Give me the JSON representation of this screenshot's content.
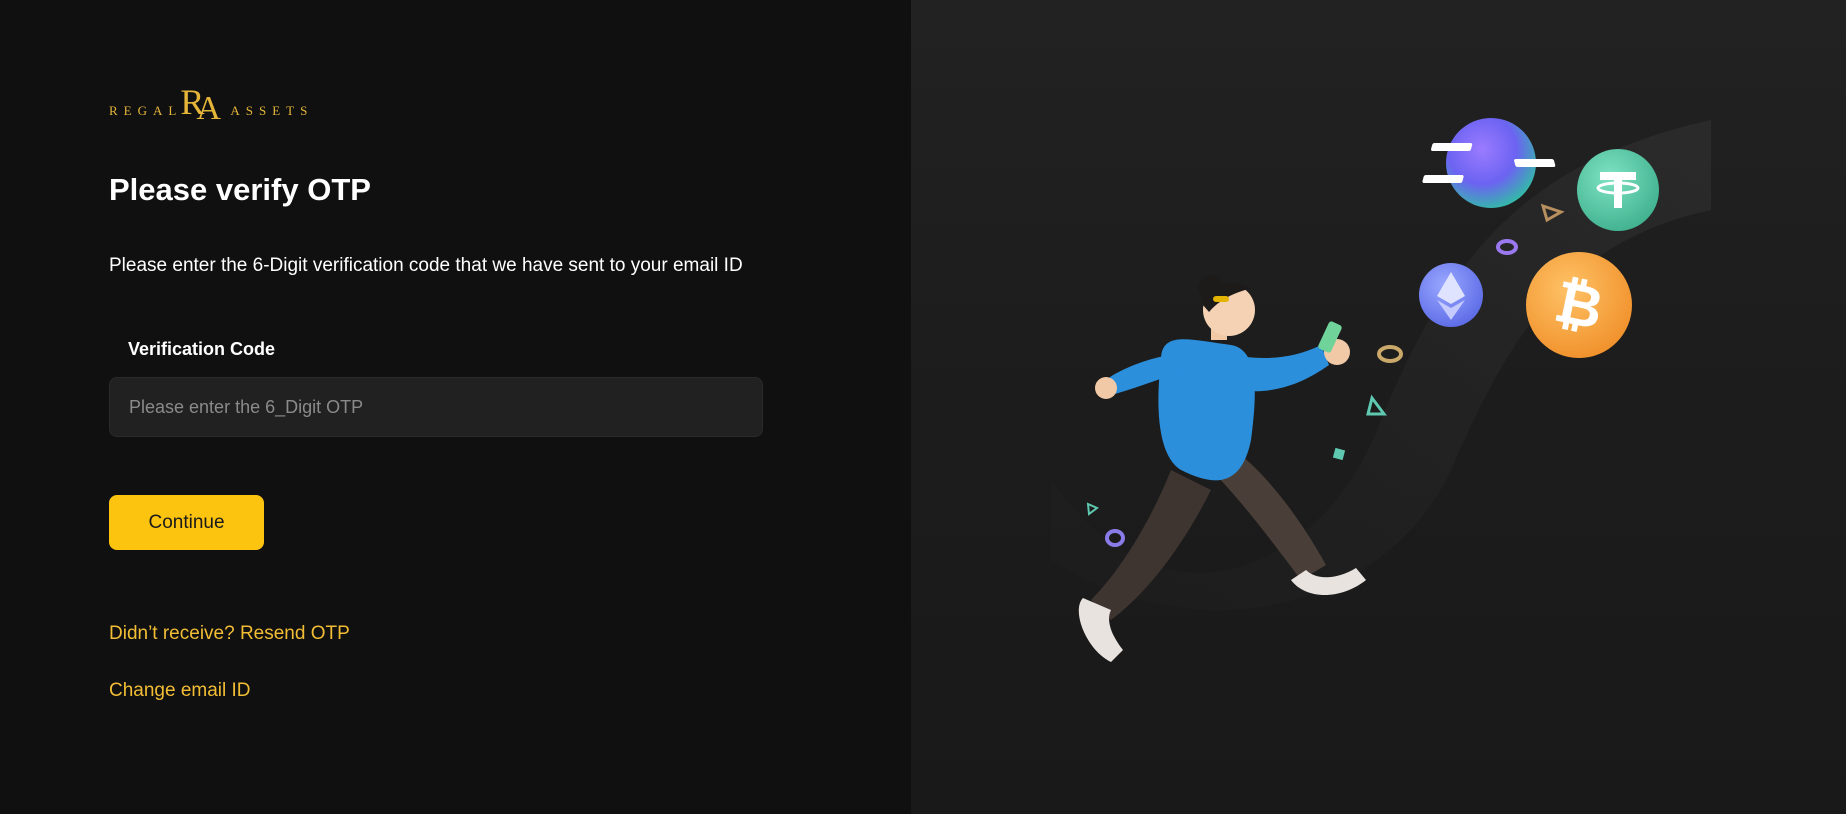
{
  "logo": {
    "left_word": "REGAL",
    "monogram_r": "R",
    "monogram_a": "A",
    "right_word": "ASSETS"
  },
  "form": {
    "title": "Please verify OTP",
    "subtitle": "Please enter the 6-Digit verification code that we have sent to your email ID",
    "field_label": "Verification Code",
    "field_placeholder": "Please enter the 6_Digit OTP",
    "field_value": "",
    "continue_label": "Continue",
    "resend_link": "Didn’t receive? Resend OTP",
    "change_email_link": "Change email ID"
  },
  "colors": {
    "accent": "#fdc40f",
    "link": "#f2bd35",
    "background": "#101010",
    "input_bg": "#212121"
  },
  "illustration": {
    "icons": [
      "solana-coin-icon",
      "tether-coin-icon",
      "ethereum-coin-icon",
      "bitcoin-coin-icon",
      "running-person-illustration"
    ]
  }
}
